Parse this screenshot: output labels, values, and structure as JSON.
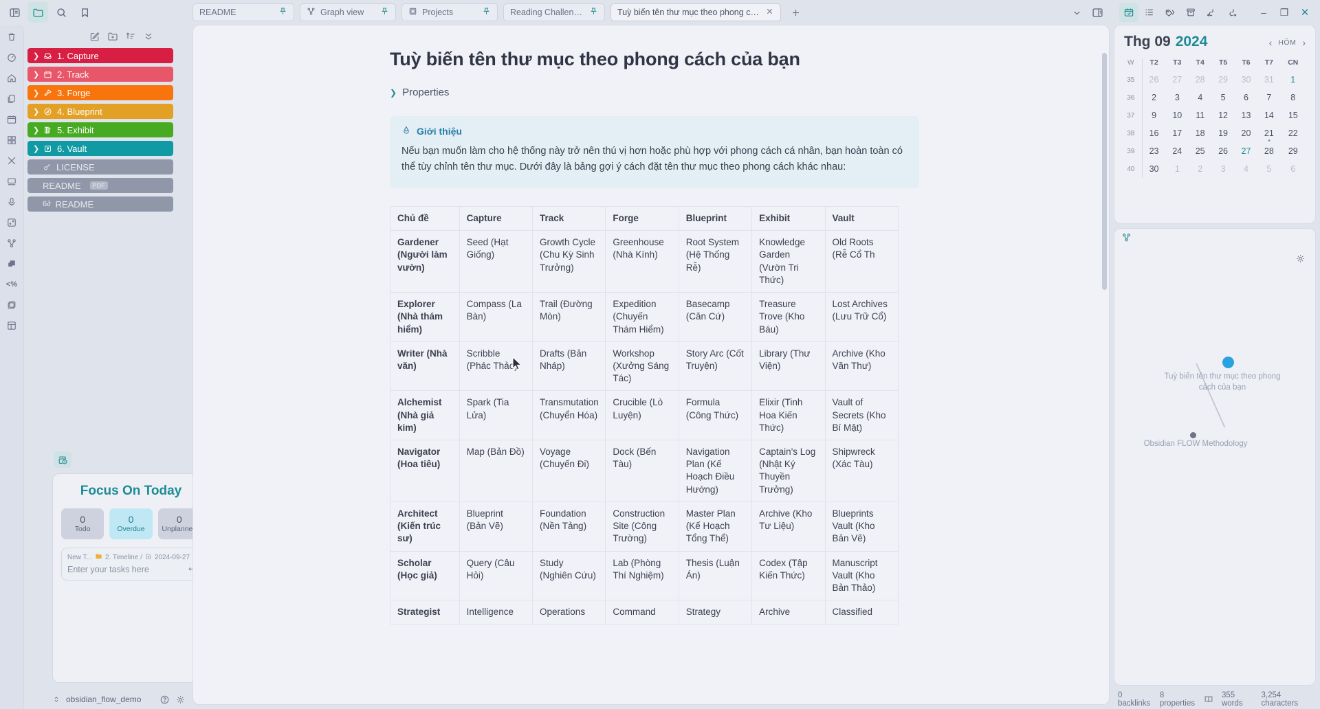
{
  "window": {
    "minimize_label": "–",
    "maximize_label": "❐",
    "close_label": "✕"
  },
  "tabs": [
    {
      "label": "README",
      "icon": "none",
      "pinned": true
    },
    {
      "label": "Graph view",
      "icon": "graph-icon",
      "pinned": true
    },
    {
      "label": "Projects",
      "icon": "projects-icon",
      "pinned": true
    },
    {
      "label": "Reading Challenges",
      "icon": "none",
      "pinned": true
    },
    {
      "label": "Tuỳ biến tên thư mục theo phong cách của bạn",
      "icon": "none",
      "pinned": false,
      "active": true
    }
  ],
  "sidebar": {
    "folders": [
      {
        "label": "1. Capture",
        "icon": "inbox-icon",
        "color": "#d61f43"
      },
      {
        "label": "2. Track",
        "icon": "calendar-icon",
        "color": "#e8566a"
      },
      {
        "label": "3. Forge",
        "icon": "hammer-icon",
        "color": "#f8740d"
      },
      {
        "label": "4. Blueprint",
        "icon": "compass-icon",
        "color": "#e2a024"
      },
      {
        "label": "5. Exhibit",
        "icon": "books-icon",
        "color": "#46ab21"
      },
      {
        "label": "6. Vault",
        "icon": "vault-icon",
        "color": "#109aa4"
      }
    ],
    "files": [
      {
        "label": "LICENSE",
        "icon": "key-icon",
        "badge": ""
      },
      {
        "label": "README",
        "icon": "none",
        "badge": "PDF"
      },
      {
        "label": "README",
        "icon": "markdown-icon",
        "badge": ""
      }
    ]
  },
  "focus": {
    "title": "Focus On Today",
    "counters": [
      {
        "count": "0",
        "label": "Todo",
        "highlight": false
      },
      {
        "count": "0",
        "label": "Overdue",
        "highlight": true
      },
      {
        "count": "0",
        "label": "Unplanned",
        "highlight": false
      }
    ],
    "task": {
      "prefix": "New T...",
      "folder": "2. Timeline /",
      "date": "2024-09-27",
      "placeholder": "Enter your tasks here",
      "enter_key": "↵"
    }
  },
  "status_left": {
    "vault": "obsidian_flow_demo",
    "help_icon": "question-icon",
    "settings_icon": "gear-icon"
  },
  "document": {
    "title": "Tuỳ biến tên thư mục theo phong cách của bạn",
    "properties_label": "Properties",
    "callout": {
      "title": "Giới thiệu",
      "icon": "flame-icon",
      "body": "Nếu bạn muốn làm cho hệ thống này trở nên thú vị hơn hoặc phù hợp với phong cách cá nhân, bạn hoàn toàn có thể tùy chỉnh tên thư mục. Dưới đây là bảng gợi ý cách đặt tên thư mục theo phong cách khác nhau:"
    },
    "table": {
      "headers": [
        "Chủ đề",
        "Capture",
        "Track",
        "Forge",
        "Blueprint",
        "Exhibit",
        "Vault"
      ],
      "rows": [
        [
          "Gardener (Người làm vườn)",
          "Seed (Hạt Giống)",
          "Growth Cycle (Chu Kỳ Sinh Trưởng)",
          "Greenhouse (Nhà Kính)",
          "Root System (Hệ Thống Rễ)",
          "Knowledge Garden (Vườn Tri Thức)",
          "Old Roots (Rễ Cổ Th"
        ],
        [
          "Explorer (Nhà thám hiểm)",
          "Compass (La Bàn)",
          "Trail (Đường Mòn)",
          "Expedition (Chuyến Thám Hiểm)",
          "Basecamp (Căn Cứ)",
          "Treasure Trove (Kho Báu)",
          "Lost Archives (Lưu Trữ Cổ)"
        ],
        [
          "Writer (Nhà văn)",
          "Scribble (Phác Thảo)",
          "Drafts (Bản Nháp)",
          "Workshop (Xưởng Sáng Tác)",
          "Story Arc (Cốt Truyện)",
          "Library (Thư Viện)",
          "Archive (Kho Văn Thư)"
        ],
        [
          "Alchemist (Nhà giả kim)",
          "Spark (Tia Lửa)",
          "Transmutation (Chuyển Hóa)",
          "Crucible (Lò Luyện)",
          "Formula (Công Thức)",
          "Elixir (Tinh Hoa Kiến Thức)",
          "Vault of Secrets (Kho Bí Mật)"
        ],
        [
          "Navigator (Hoa tiêu)",
          "Map (Bản Đồ)",
          "Voyage (Chuyến Đi)",
          "Dock (Bến Tàu)",
          "Navigation Plan (Kế Hoạch Điều Hướng)",
          "Captain's Log (Nhật Ký Thuyền Trưởng)",
          "Shipwreck (Xác Tàu)"
        ],
        [
          "Architect (Kiến trúc sư)",
          "Blueprint (Bản Vẽ)",
          "Foundation (Nền Tảng)",
          "Construction Site (Công Trường)",
          "Master Plan (Kế Hoạch Tổng Thể)",
          "Archive (Kho Tư Liệu)",
          "Blueprints Vault (Kho Bản Vẽ)"
        ],
        [
          "Scholar (Học giả)",
          "Query (Câu Hỏi)",
          "Study (Nghiên Cứu)",
          "Lab (Phòng Thí Nghiệm)",
          "Thesis (Luận Án)",
          "Codex (Tập Kiến Thức)",
          "Manuscript Vault (Kho Bản Thảo)"
        ],
        [
          "Strategist",
          "Intelligence",
          "Operations",
          "Command",
          "Strategy",
          "Archive",
          "Classified"
        ]
      ]
    }
  },
  "calendar": {
    "month": "Thg 09",
    "year": "2024",
    "today_label": "HÔM",
    "prev_icon": "chevron-left-icon",
    "next_icon": "chevron-right-icon",
    "weekday_headers": [
      "W",
      "T2",
      "T3",
      "T4",
      "T5",
      "T6",
      "T7",
      "CN"
    ],
    "weeks": [
      {
        "num": "35",
        "days": [
          {
            "d": "26",
            "out": true
          },
          {
            "d": "27",
            "out": true
          },
          {
            "d": "28",
            "out": true
          },
          {
            "d": "29",
            "out": true
          },
          {
            "d": "30",
            "out": true
          },
          {
            "d": "31",
            "out": true
          },
          {
            "d": "1",
            "out": false,
            "accent": true
          }
        ]
      },
      {
        "num": "36",
        "days": [
          {
            "d": "2"
          },
          {
            "d": "3"
          },
          {
            "d": "4"
          },
          {
            "d": "5"
          },
          {
            "d": "6"
          },
          {
            "d": "7"
          },
          {
            "d": "8"
          }
        ]
      },
      {
        "num": "37",
        "days": [
          {
            "d": "9"
          },
          {
            "d": "10"
          },
          {
            "d": "11"
          },
          {
            "d": "12"
          },
          {
            "d": "13"
          },
          {
            "d": "14"
          },
          {
            "d": "15"
          }
        ]
      },
      {
        "num": "38",
        "days": [
          {
            "d": "16"
          },
          {
            "d": "17"
          },
          {
            "d": "18"
          },
          {
            "d": "19"
          },
          {
            "d": "20"
          },
          {
            "d": "21",
            "dot": true
          },
          {
            "d": "22"
          }
        ]
      },
      {
        "num": "39",
        "days": [
          {
            "d": "23"
          },
          {
            "d": "24"
          },
          {
            "d": "25"
          },
          {
            "d": "26"
          },
          {
            "d": "27",
            "accent": true
          },
          {
            "d": "28"
          },
          {
            "d": "29"
          }
        ]
      },
      {
        "num": "40",
        "days": [
          {
            "d": "30"
          },
          {
            "d": "1",
            "out": true
          },
          {
            "d": "2",
            "out": true
          },
          {
            "d": "3",
            "out": true
          },
          {
            "d": "4",
            "out": true
          },
          {
            "d": "5",
            "out": true
          },
          {
            "d": "6",
            "out": true
          }
        ]
      }
    ]
  },
  "graph": {
    "node_main": "Tuỳ biến tên thư mục theo phong cách của bạn",
    "node_other": "Obsidian FLOW Methodology",
    "node_main_color": "#29a3e0",
    "node_other_color": "#6d7488"
  },
  "status_right": {
    "backlinks": "0 backlinks",
    "properties": "8 properties",
    "words": "355 words",
    "characters": "3,254 characters",
    "book_icon": "book-icon"
  }
}
